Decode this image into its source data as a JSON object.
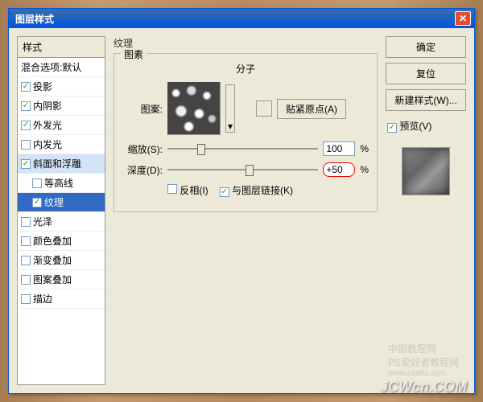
{
  "dialog": {
    "title": "图层样式"
  },
  "left": {
    "header": "样式",
    "blend_options": "混合选项:默认",
    "items": [
      {
        "label": "投影",
        "checked": true
      },
      {
        "label": "内阴影",
        "checked": true
      },
      {
        "label": "外发光",
        "checked": true
      },
      {
        "label": "内发光",
        "checked": false
      },
      {
        "label": "斜面和浮雕",
        "checked": true,
        "selected": false
      },
      {
        "label": "等高线",
        "checked": false,
        "sub": true
      },
      {
        "label": "纹理",
        "checked": true,
        "sub": true,
        "selected": true
      },
      {
        "label": "光泽",
        "checked": false
      },
      {
        "label": "颜色叠加",
        "checked": false
      },
      {
        "label": "渐变叠加",
        "checked": false
      },
      {
        "label": "图案叠加",
        "checked": false
      },
      {
        "label": "描边",
        "checked": false
      }
    ]
  },
  "center": {
    "section": "纹理",
    "group_label": "图素",
    "molecule_label": "分子",
    "pattern_label": "图案:",
    "snap_btn": "贴紧原点(A)",
    "scale_label": "缩放(S):",
    "scale_value": "100",
    "depth_label": "深度(D):",
    "depth_value": "+50",
    "percent": "%",
    "invert_label": "反相(I)",
    "link_label": "与图层链接(K)",
    "invert_checked": false,
    "link_checked": true
  },
  "right": {
    "ok": "确定",
    "cancel": "复位",
    "new_style": "新建样式(W)...",
    "preview": "预览(V)",
    "preview_checked": true
  },
  "watermark": {
    "main": "JCWcn.COM",
    "sub": "PS爱好者教程网",
    "url": "www.psahz.com",
    "cn": "中国教程网"
  }
}
